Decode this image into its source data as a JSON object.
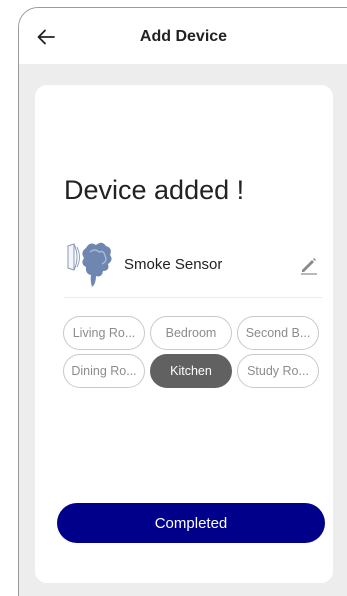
{
  "header": {
    "title": "Add Device",
    "back_icon": "arrow-left-icon"
  },
  "main": {
    "title": "Device added !",
    "device": {
      "icon": "smoke-sensor-icon",
      "name": "Smoke Sensor",
      "edit_icon": "pencil-icon"
    },
    "rooms": [
      {
        "label": "Living Ro...",
        "selected": false
      },
      {
        "label": "Bedroom",
        "selected": false
      },
      {
        "label": "Second B...",
        "selected": false
      },
      {
        "label": "Dining Ro...",
        "selected": false
      },
      {
        "label": "Kitchen",
        "selected": true
      },
      {
        "label": "Study Ro...",
        "selected": false
      }
    ],
    "completed_label": "Completed"
  },
  "colors": {
    "accent": "#00008b",
    "selected_chip": "#616161",
    "background": "#ededed"
  }
}
